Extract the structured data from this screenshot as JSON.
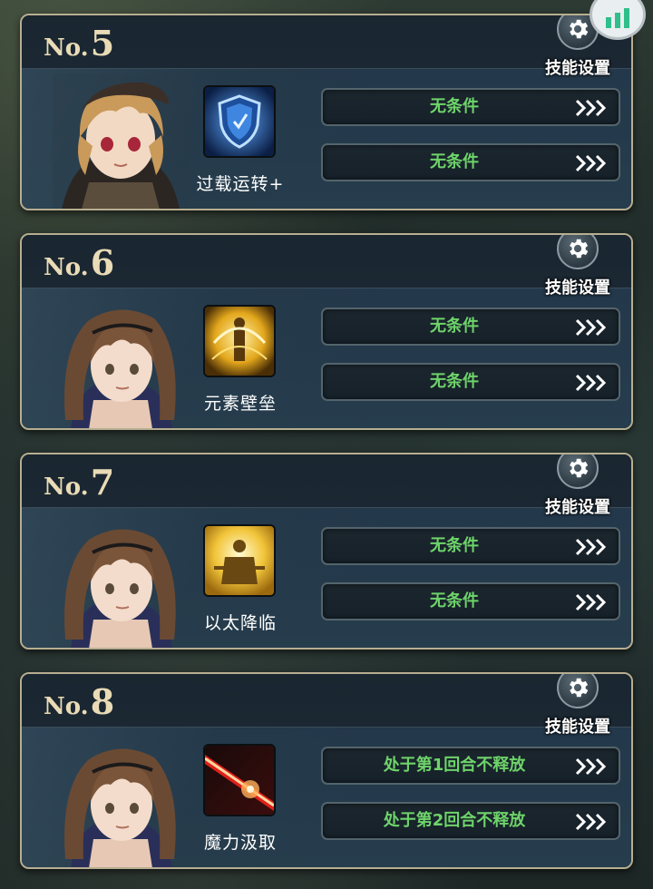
{
  "colors": {
    "condition_text": "#6ed36a",
    "gold": "#e9dbb6",
    "card_border": "#b7ae91"
  },
  "top_badge_icon": "signal-bars-icon",
  "cards": [
    {
      "no_prefix": "No.",
      "no_number": "5",
      "settings_label": "技能设置",
      "settings_icon": "gear-icon",
      "portrait": "blonde-hooded-girl-portrait",
      "skill": {
        "name": "过载运转+",
        "icon": "blue-shield-skill-icon"
      },
      "conditions": [
        {
          "text": "无条件",
          "arrow_icon": "triple-chevron-right-icon"
        },
        {
          "text": "无条件",
          "arrow_icon": "triple-chevron-right-icon"
        }
      ]
    },
    {
      "no_prefix": "No.",
      "no_number": "6",
      "settings_label": "技能设置",
      "settings_icon": "gear-icon",
      "portrait": "brown-haired-girl-portrait",
      "skill": {
        "name": "元素壁垒",
        "icon": "golden-barrier-skill-icon"
      },
      "conditions": [
        {
          "text": "无条件",
          "arrow_icon": "triple-chevron-right-icon"
        },
        {
          "text": "无条件",
          "arrow_icon": "triple-chevron-right-icon"
        }
      ]
    },
    {
      "no_prefix": "No.",
      "no_number": "7",
      "settings_label": "技能设置",
      "settings_icon": "gear-icon",
      "portrait": "brown-haired-girl-portrait",
      "skill": {
        "name": "以太降临",
        "icon": "golden-knight-skill-icon"
      },
      "conditions": [
        {
          "text": "无条件",
          "arrow_icon": "triple-chevron-right-icon"
        },
        {
          "text": "无条件",
          "arrow_icon": "triple-chevron-right-icon"
        }
      ]
    },
    {
      "no_prefix": "No.",
      "no_number": "8",
      "settings_label": "技能设置",
      "settings_icon": "gear-icon",
      "portrait": "brown-haired-girl-portrait",
      "skill": {
        "name": "魔力汲取",
        "icon": "red-beam-skill-icon"
      },
      "conditions": [
        {
          "text": "处于第1回合不释放",
          "arrow_icon": "triple-chevron-right-icon"
        },
        {
          "text": "处于第2回合不释放",
          "arrow_icon": "triple-chevron-right-icon"
        }
      ]
    }
  ]
}
